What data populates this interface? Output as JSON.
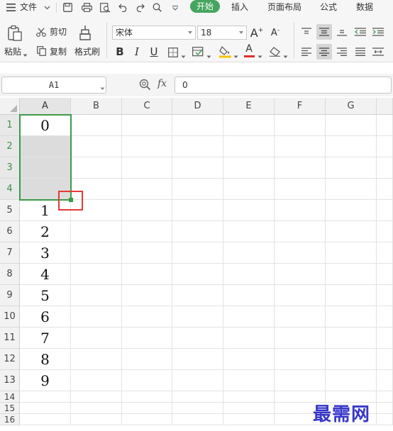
{
  "menu": {
    "file_label": "文件",
    "tabs": [
      "开始",
      "插入",
      "页面布局",
      "公式",
      "数据"
    ]
  },
  "ribbon": {
    "paste_label": "粘贴",
    "cut_label": "剪切",
    "copy_label": "复制",
    "format_painter_label": "格式刷",
    "font_name": "宋体",
    "font_size": "18",
    "bold": "B",
    "italic": "I",
    "underline": "U",
    "font_color_glyph": "A",
    "font_color": "#e03030",
    "fill_color": "#f5c400",
    "grow_font": "A",
    "shrink_font": "A"
  },
  "formula_bar": {
    "name_box": "A1",
    "fx_label": "fx",
    "formula_value": "0"
  },
  "sheet": {
    "columns": [
      "A",
      "B",
      "C",
      "D",
      "E",
      "F",
      "G"
    ],
    "rows": [
      "1",
      "2",
      "3",
      "4",
      "5",
      "6",
      "7",
      "8",
      "9",
      "10",
      "11",
      "12",
      "13",
      "14",
      "15",
      "16"
    ],
    "column_a_values": [
      "0",
      "",
      "",
      "",
      "1",
      "2",
      "3",
      "4",
      "5",
      "6",
      "7",
      "8",
      "9",
      "",
      "",
      ""
    ],
    "selected_range": "A1:A4",
    "selection_color": "#3c9a48",
    "fill_handle_highlight_color": "#e53935"
  },
  "watermark": "最需网"
}
